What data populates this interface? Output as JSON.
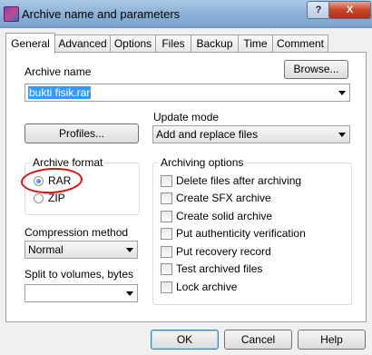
{
  "window": {
    "title": "Archive name and parameters",
    "help_glyph": "?",
    "close_glyph": "X"
  },
  "tabs": [
    {
      "label": "General",
      "active": true
    },
    {
      "label": "Advanced"
    },
    {
      "label": "Options"
    },
    {
      "label": "Files"
    },
    {
      "label": "Backup"
    },
    {
      "label": "Time"
    },
    {
      "label": "Comment"
    }
  ],
  "archive_name": {
    "label": "Archive name",
    "value": "bukti fisik.rar",
    "browse_label": "Browse..."
  },
  "profiles_label": "Profiles...",
  "update_mode": {
    "label": "Update mode",
    "value": "Add and replace files"
  },
  "archive_format": {
    "label": "Archive format",
    "options": [
      {
        "label": "RAR",
        "checked": true
      },
      {
        "label": "ZIP",
        "checked": false
      }
    ]
  },
  "compression": {
    "label": "Compression method",
    "value": "Normal"
  },
  "split": {
    "label": "Split to volumes, bytes",
    "value": ""
  },
  "archiving_options": {
    "label": "Archiving options",
    "items": [
      {
        "label": "Delete files after archiving",
        "checked": false
      },
      {
        "label": "Create SFX archive",
        "checked": false
      },
      {
        "label": "Create solid archive",
        "checked": false
      },
      {
        "label": "Put authenticity verification",
        "checked": false
      },
      {
        "label": "Put recovery record",
        "checked": false
      },
      {
        "label": "Test archived files",
        "checked": false
      },
      {
        "label": "Lock archive",
        "checked": false
      }
    ]
  },
  "buttons": {
    "ok": "OK",
    "cancel": "Cancel",
    "help": "Help"
  },
  "colors": {
    "selection": "#3399ff",
    "annotation": "#e01010"
  }
}
